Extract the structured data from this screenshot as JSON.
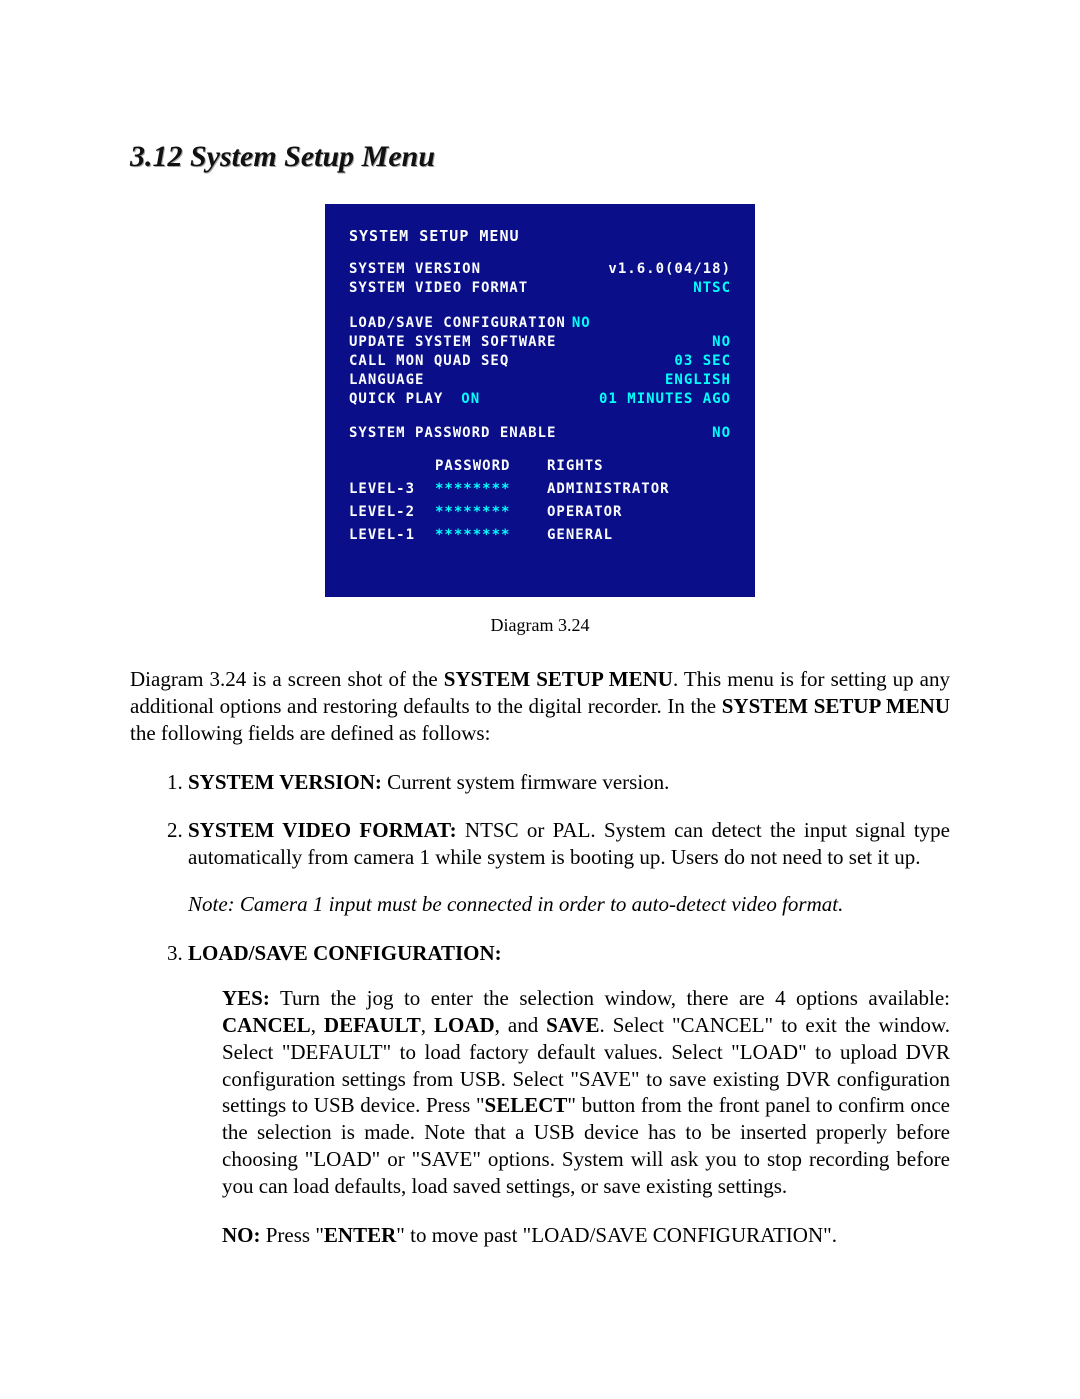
{
  "heading": "3.12 System Setup Menu",
  "dvr": {
    "title": "SYSTEM SETUP MENU",
    "rows1": {
      "version_label": "SYSTEM VERSION",
      "version_value": "v1.6.0(04/18)",
      "format_label": "SYSTEM VIDEO FORMAT",
      "format_value": "NTSC"
    },
    "rows2": {
      "loadsave_label": "LOAD/SAVE CONFIGURATION",
      "loadsave_value": "NO",
      "update_label": "UPDATE SYSTEM SOFTWARE",
      "update_value": "NO",
      "callmon_label": "CALL MON QUAD SEQ",
      "callmon_value": "03 SEC",
      "language_label": "LANGUAGE",
      "language_value": "ENGLISH",
      "quickplay_label": "QUICK PLAY",
      "quickplay_on": "ON",
      "quickplay_amount": "01 MINUTES AGO"
    },
    "password_enable_label": "SYSTEM PASSWORD ENABLE",
    "password_enable_value": "NO",
    "table_headers": {
      "password": "PASSWORD",
      "rights": "RIGHTS"
    },
    "levels": [
      {
        "name": "LEVEL-3",
        "password": "********",
        "rights": "ADMINISTRATOR"
      },
      {
        "name": "LEVEL-2",
        "password": "********",
        "rights": "OPERATOR"
      },
      {
        "name": "LEVEL-1",
        "password": "********",
        "rights": "GENERAL"
      }
    ]
  },
  "caption": "Diagram 3.24",
  "intro": {
    "a": "Diagram 3.24 is a screen shot of the ",
    "b": "SYSTEM SETUP MENU",
    "c": ". This menu is for setting up any additional options and restoring defaults to the digital recorder. In the ",
    "d": "SYSTEM SETUP MENU",
    "e": " the following fields are defined as follows:"
  },
  "item1": {
    "label": "SYSTEM VERSION:",
    "text": " Current system firmware version."
  },
  "item2": {
    "label": "SYSTEM VIDEO FORMAT:",
    "text": " NTSC or PAL. System can detect the input signal type automatically from camera 1 while system is booting up. Users do not need to set it up.",
    "note": "Note: Camera 1 input must be connected in order to auto-detect video format."
  },
  "item3": {
    "label": "LOAD/SAVE CONFIGURATION:",
    "yes": {
      "lead": "YES:",
      "a": " Turn the jog to enter the selection window, there are 4 options available: ",
      "opt1": "CANCEL",
      "c1": ", ",
      "opt2": "DEFAULT",
      "c2": ", ",
      "opt3": "LOAD",
      "c3": ", and ",
      "opt4": "SAVE",
      "mid": ".  Select \"CANCEL\" to exit the window. Select \"DEFAULT\" to load factory default values. Select \"LOAD\" to upload DVR configuration settings from USB. Select \"SAVE\" to save existing DVR configuration settings to USB device. Press \"",
      "select": "SELECT",
      "tail": "\" button from the front panel to confirm once the selection is made. Note that a USB device has to be inserted properly before choosing \"LOAD\" or \"SAVE\" options.  System will ask you to stop recording before you can load defaults, load saved settings, or save existing settings."
    },
    "no": {
      "lead": " NO:",
      "a": " Press \"",
      "enter": "ENTER",
      "b": "\" to move past \"LOAD/SAVE  CONFIGURATION\"."
    }
  }
}
